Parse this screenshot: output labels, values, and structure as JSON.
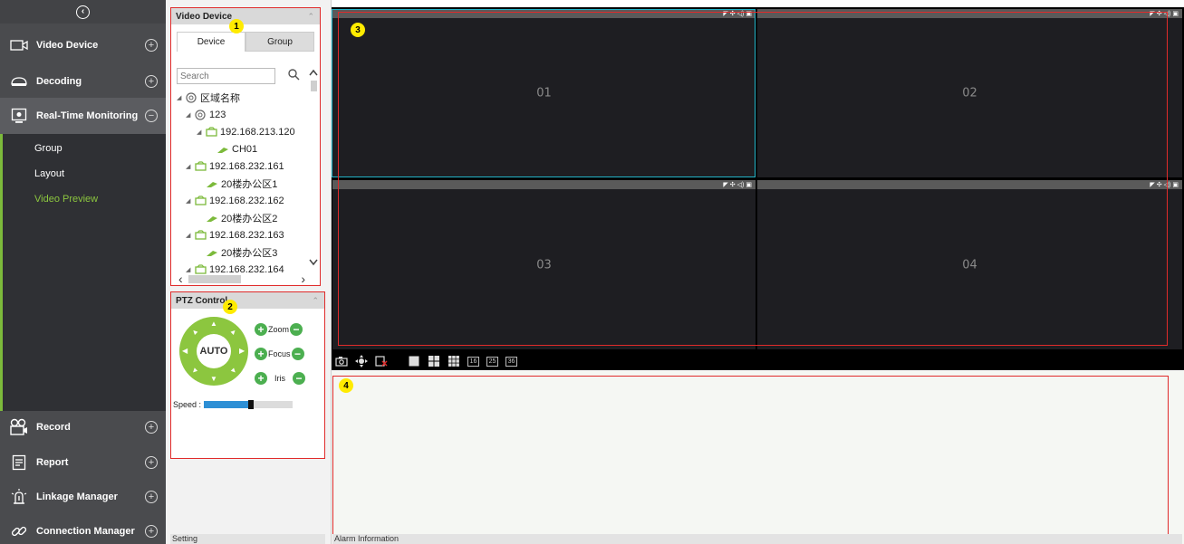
{
  "nav": {
    "items": [
      {
        "label": "Video Device",
        "toggle": "+"
      },
      {
        "label": "Decoding",
        "toggle": "+"
      },
      {
        "label": "Real-Time Monitoring",
        "toggle": "−"
      },
      {
        "label": "Record",
        "toggle": "+"
      },
      {
        "label": "Report",
        "toggle": "+"
      },
      {
        "label": "Linkage Manager",
        "toggle": "+"
      },
      {
        "label": "Connection Manager",
        "toggle": "+"
      }
    ],
    "sub_items": [
      "Group",
      "Layout",
      "Video Preview"
    ]
  },
  "video_device_panel": {
    "title": "Video Device",
    "tabs": [
      "Device",
      "Group"
    ],
    "search_placeholder": "Search",
    "tree": [
      {
        "label": "区域名称"
      },
      {
        "label": "123"
      },
      {
        "label": "192.168.213.120"
      },
      {
        "label": "CH01"
      },
      {
        "label": "192.168.232.161"
      },
      {
        "label": "20楼办公区1"
      },
      {
        "label": "192.168.232.162"
      },
      {
        "label": "20楼办公区2"
      },
      {
        "label": "192.168.232.163"
      },
      {
        "label": "20楼办公区3"
      },
      {
        "label": "192.168.232.164"
      }
    ]
  },
  "ptz_panel": {
    "title": "PTZ Control",
    "auto_label": "AUTO",
    "controls": [
      "Zoom",
      "Focus",
      "Iris"
    ],
    "speed_label": "Speed :",
    "speed_level": 0.5
  },
  "setting_label": "Setting",
  "video_cells": [
    "01",
    "02",
    "03",
    "04"
  ],
  "toolbar": {
    "layouts": [
      "16",
      "25",
      "36"
    ]
  },
  "alarm": {
    "title": "Alarm Information"
  },
  "badges": [
    "1",
    "2",
    "3",
    "4"
  ],
  "colors": {
    "accent_green": "#8cc63f",
    "annotation_red": "#e02b2b",
    "selection_cyan": "#22b4c8",
    "badge_yellow": "#ffeb00"
  }
}
